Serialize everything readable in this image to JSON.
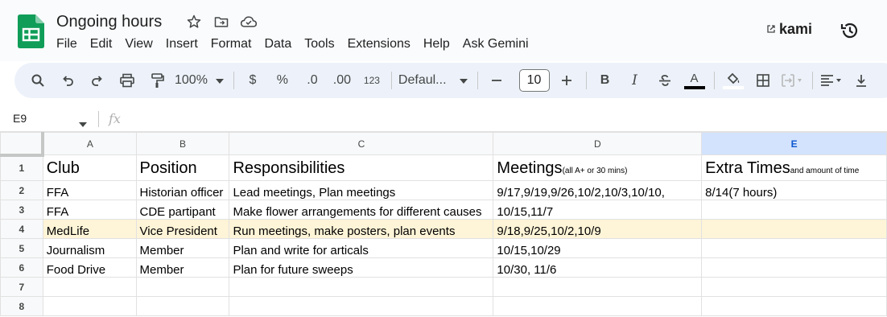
{
  "document": {
    "title": "Ongoing hours"
  },
  "menu": [
    "File",
    "Edit",
    "View",
    "Insert",
    "Format",
    "Data",
    "Tools",
    "Extensions",
    "Help",
    "Ask Gemini"
  ],
  "extensions": {
    "kami_label": "kami"
  },
  "toolbar": {
    "zoom": "100%",
    "currency": "$",
    "percent": "%",
    "decrease_decimal": ".0",
    "increase_decimal": ".00",
    "number_format": "123",
    "font_family": "Defaul...",
    "font_size": "10",
    "bold": "B",
    "italic": "I",
    "text_color": "A"
  },
  "formula_bar": {
    "cell_ref": "E9",
    "fx": "fx"
  },
  "grid": {
    "columns": [
      "A",
      "B",
      "C",
      "D",
      "E"
    ],
    "selected_column": "E",
    "rows": [
      {
        "num": "1",
        "cells": [
          "Club",
          "Position",
          "Responsibilities",
          "Meetings",
          "Extra Times"
        ],
        "notes": {
          "D": "(all A+ or 30 mins)",
          "E": "and amount of time"
        }
      },
      {
        "num": "2",
        "cells": [
          "FFA",
          "Historian officer",
          "Lead meetings, Plan meetings",
          "9/17,9/19,9/26,10/2,10/3,10/10,",
          "8/14(7 hours)"
        ]
      },
      {
        "num": "3",
        "cells": [
          "FFA",
          "CDE partipant",
          "Make flower arrangements for different causes",
          "10/15,11/7",
          ""
        ]
      },
      {
        "num": "4",
        "cells": [
          "MedLife",
          "Vice President",
          "Run meetings, make posters, plan events",
          "9/18,9/25,10/2,10/9",
          ""
        ],
        "highlighted": true
      },
      {
        "num": "5",
        "cells": [
          "Journalism",
          "Member",
          "Plan and write for articals",
          "10/15,10/29",
          ""
        ]
      },
      {
        "num": "6",
        "cells": [
          "Food Drive",
          "Member",
          "Plan for future sweeps",
          "10/30, 11/6",
          ""
        ]
      },
      {
        "num": "7",
        "cells": [
          "",
          "",
          "",
          "",
          ""
        ]
      },
      {
        "num": "8",
        "cells": [
          "",
          "",
          "",
          "",
          ""
        ]
      }
    ]
  },
  "colors": {
    "highlight_row": "#fef4d7",
    "selected_header": "#d3e3fd",
    "sheets_green": "#0f9d58"
  }
}
